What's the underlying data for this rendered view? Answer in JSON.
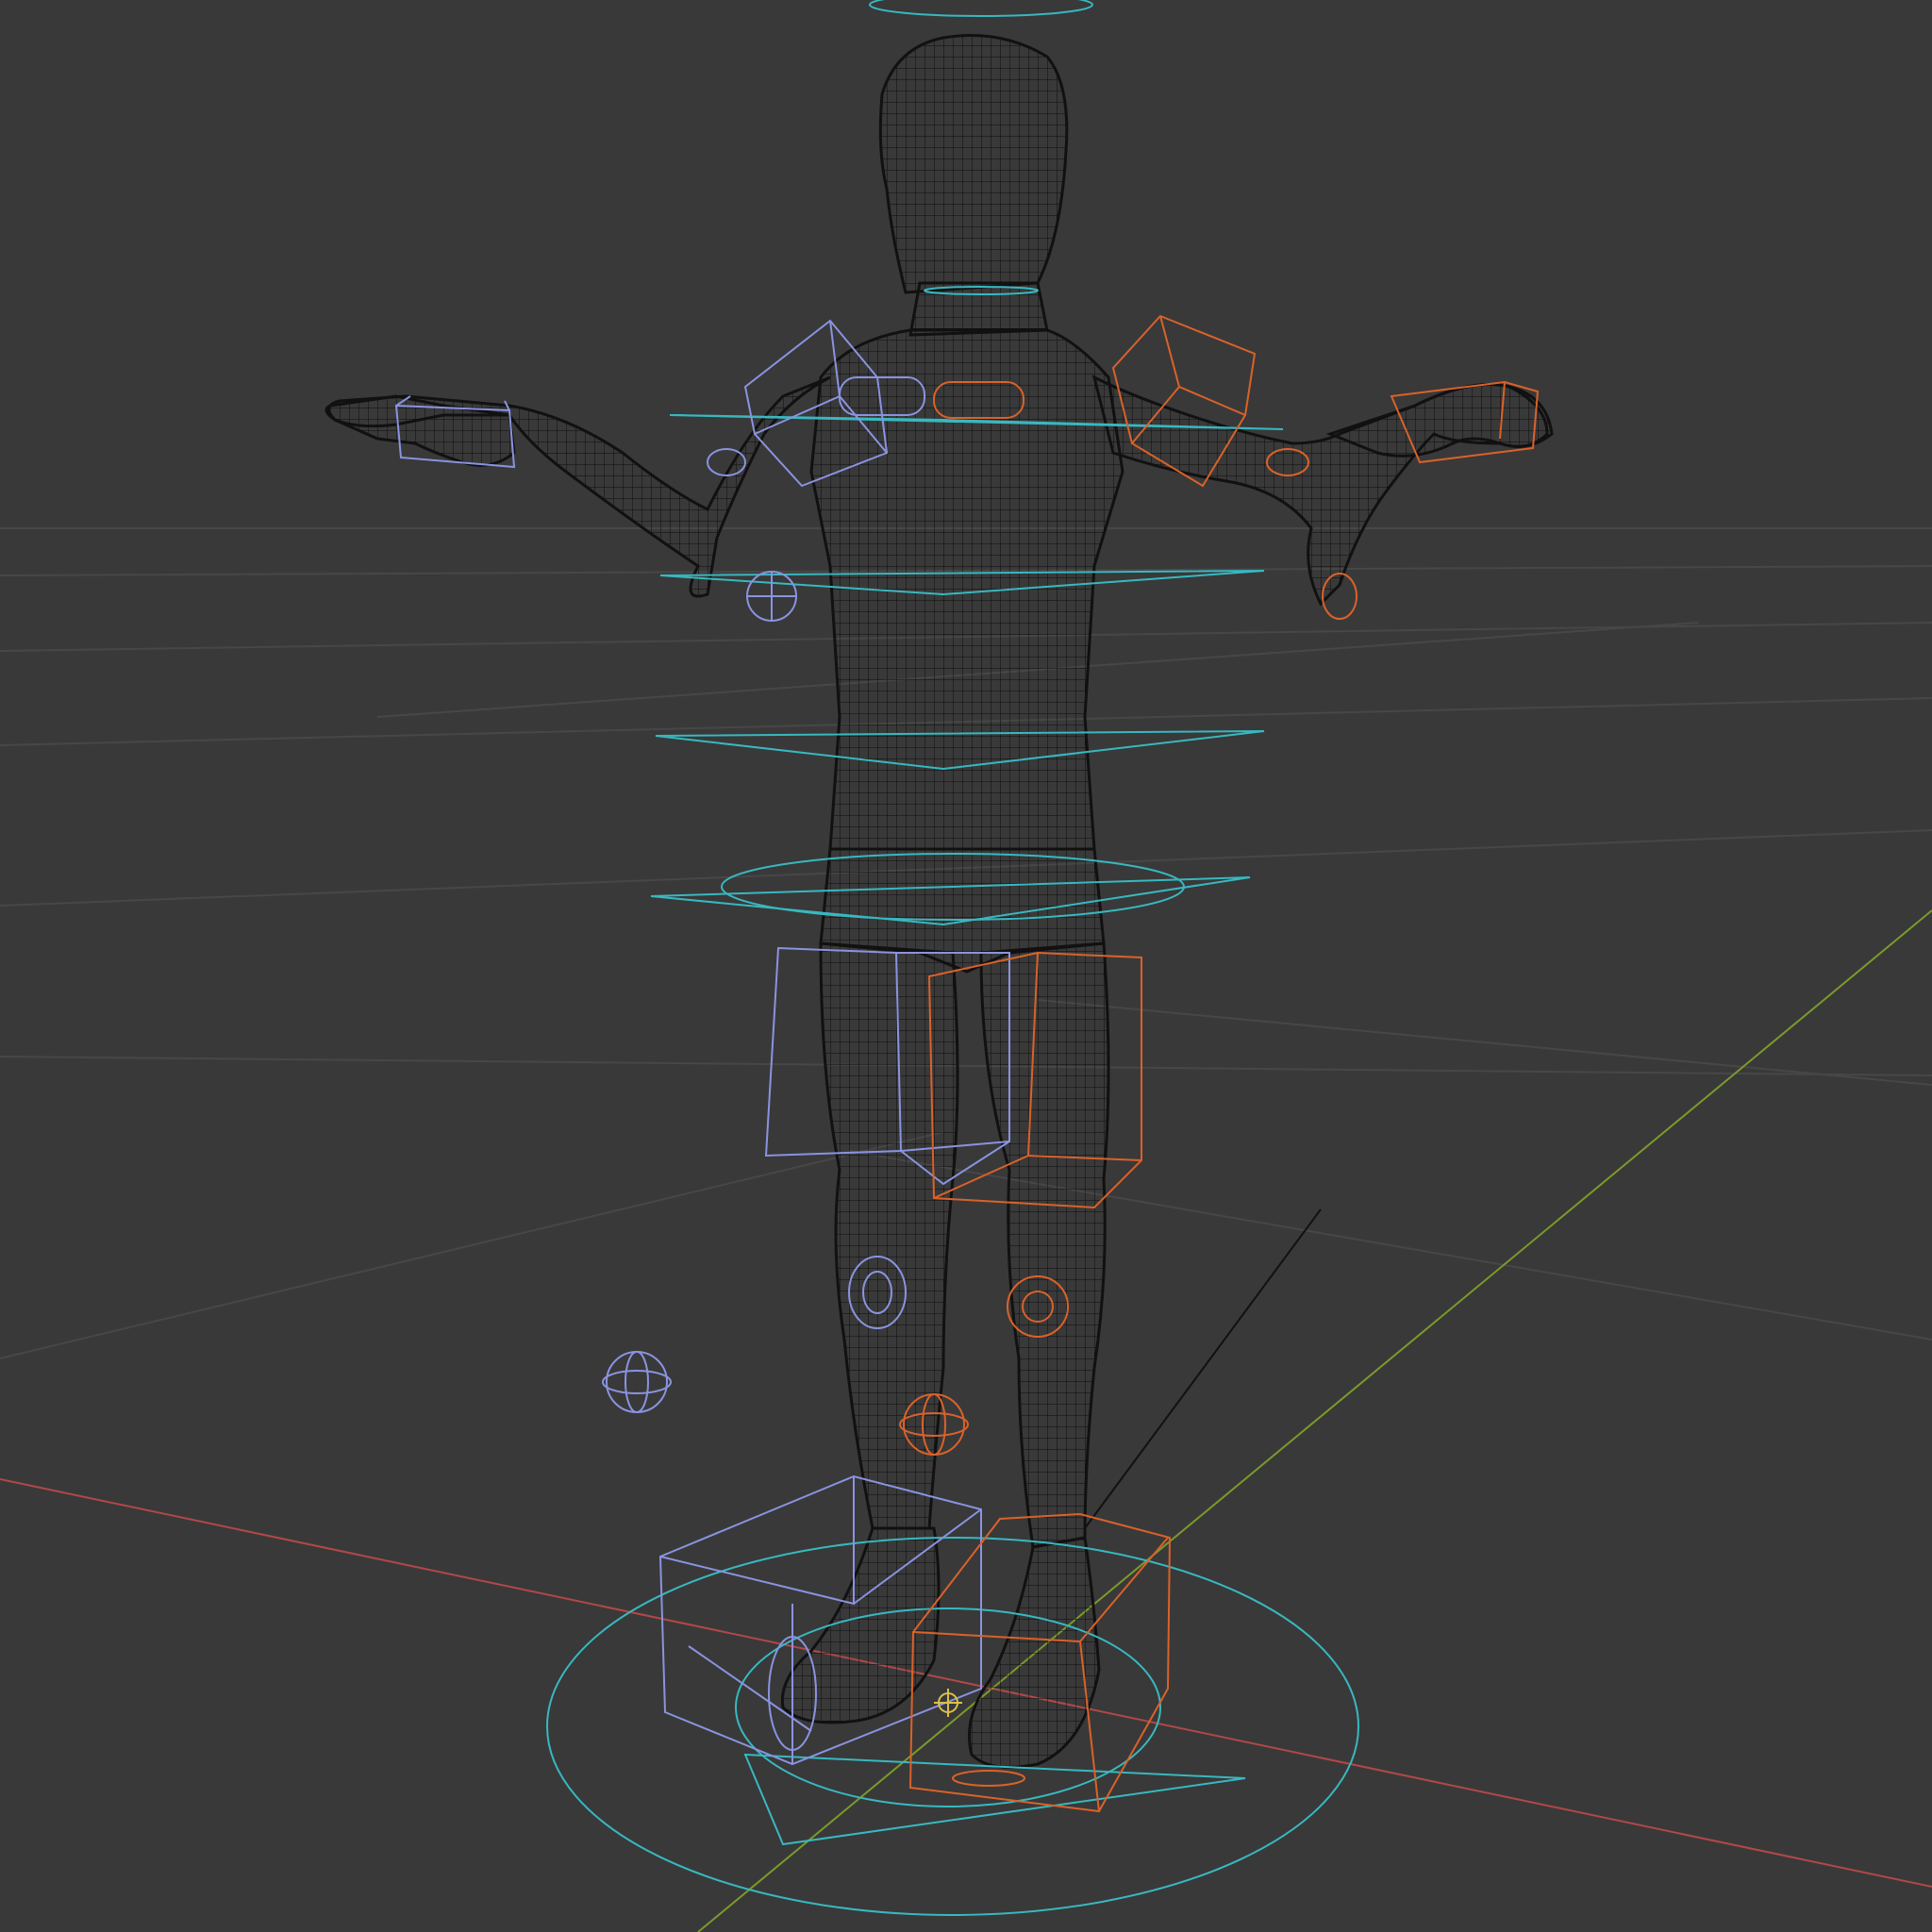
{
  "viewport": {
    "mode": "wireframe",
    "background": "#393939",
    "grid_color": "#4a4a4a",
    "x_axis_color": "#b24848",
    "y_axis_color": "#7a9a2a",
    "mesh_color": "#0d0d0d",
    "left_controls_color": "#8a93e0",
    "right_controls_color": "#d9622a",
    "center_controls_color": "#38b8c0"
  },
  "scene": {
    "object": "character-mesh",
    "rig": "control-rig"
  }
}
